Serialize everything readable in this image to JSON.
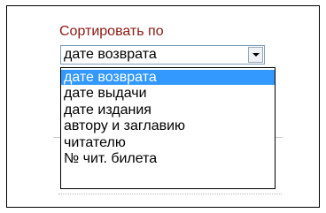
{
  "sort": {
    "label": "Сортировать по",
    "selected_value": "дате возврата",
    "options": [
      {
        "label": "дате возврата",
        "highlighted": true
      },
      {
        "label": "дате выдачи",
        "highlighted": false
      },
      {
        "label": "дате издания",
        "highlighted": false
      },
      {
        "label": "автору и заглавию",
        "highlighted": false
      },
      {
        "label": "читателю",
        "highlighted": false
      },
      {
        "label": "№ чит. билета",
        "highlighted": false
      }
    ]
  },
  "colors": {
    "label_color": "#8b1a12",
    "highlight_color": "#3399ff",
    "select_border": "#7f9db9"
  }
}
